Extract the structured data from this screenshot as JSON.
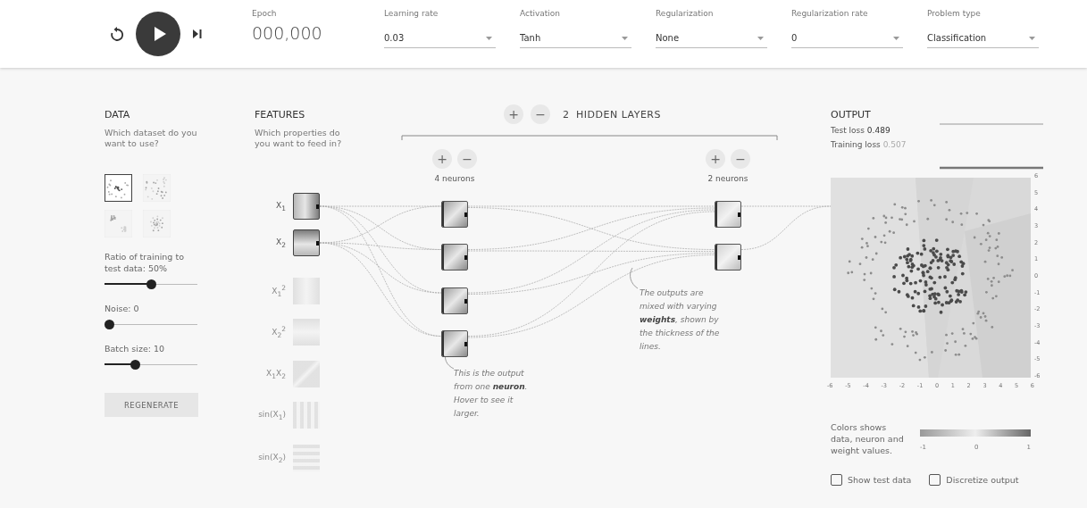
{
  "toolbar": {
    "playing": false,
    "epoch": {
      "label": "Epoch",
      "value": "000,000"
    },
    "dropdowns": [
      {
        "label": "Learning rate",
        "value": "0.03"
      },
      {
        "label": "Activation",
        "value": "Tanh"
      },
      {
        "label": "Regularization",
        "value": "None"
      },
      {
        "label": "Regularization rate",
        "value": "0"
      },
      {
        "label": "Problem type",
        "value": "Classification"
      }
    ]
  },
  "data": {
    "title": "DATA",
    "subtitle": "Which dataset do you want to use?",
    "datasets": [
      {
        "kind": "circle",
        "selected": true
      },
      {
        "kind": "xor",
        "selected": false
      },
      {
        "kind": "gaussian",
        "selected": false
      },
      {
        "kind": "spiral",
        "selected": false
      }
    ],
    "sliders": [
      {
        "label": "Ratio of training to test data:  50%",
        "level": 0.5
      },
      {
        "label": "Noise:  0",
        "level": 0
      },
      {
        "label": "Batch size:  10",
        "level": 0.31
      }
    ],
    "button": "REGENERATE"
  },
  "features": {
    "title": "FEATURES",
    "subtitle": "Which properties do you want to feed in?",
    "items": [
      {
        "label": "X$_{1}$",
        "kind": "x1",
        "selected": true
      },
      {
        "label": "X$_{2}$",
        "kind": "x2",
        "selected": true
      },
      {
        "label": "X$_{1}$$^{2}$",
        "kind": "x1sq",
        "selected": false
      },
      {
        "label": "X$_{2}$$^{2}$",
        "kind": "x2sq",
        "selected": false
      },
      {
        "label": "X$_{1}$X$_{2}$",
        "kind": "x1x2",
        "selected": false
      },
      {
        "label": "sin(X$_{1}$)",
        "kind": "sin1",
        "selected": false
      },
      {
        "label": "sin(X$_{2}$)",
        "kind": "sin2",
        "selected": false
      }
    ]
  },
  "network": {
    "add": "+",
    "remove": "−",
    "count": "2",
    "title": "HIDDEN LAYERS",
    "layers": [
      {
        "add": "+",
        "remove": "−",
        "label": "4 neurons",
        "neurons": [
          {
            "kind": "diagonal"
          },
          {
            "kind": "diagonal"
          },
          {
            "kind": "diagonal"
          },
          {
            "kind": "diagonal"
          }
        ]
      },
      {
        "add": "+",
        "remove": "−",
        "label": "2 neurons",
        "neurons": [
          {
            "kind": "soft"
          },
          {
            "kind": "soft"
          }
        ]
      }
    ],
    "notes": [
      "This is the output from one **neuron**. Hover to see it larger.",
      "The outputs are mixed with varying **weights**, shown by the thickness of the lines."
    ]
  },
  "output": {
    "title": "OUTPUT",
    "losses": [
      {
        "label": "Test loss",
        "value": "0.489"
      },
      {
        "label": "Training loss",
        "value": "0.507"
      }
    ],
    "x_ticks": [
      "-6",
      "-5",
      "-4",
      "-3",
      "-2",
      "-1",
      "0",
      "1",
      "2",
      "3",
      "4",
      "5",
      "6"
    ],
    "y_ticks": [
      "6",
      "5",
      "4",
      "3",
      "2",
      "1",
      "0",
      "-1",
      "-2",
      "-3",
      "-4",
      "-5",
      "-6"
    ],
    "legend": {
      "text": "Colors shows data, neuron and weight values.",
      "scale": [
        "-1",
        "0",
        "1"
      ]
    },
    "options": [
      {
        "label": "Show test data",
        "checked": false
      },
      {
        "label": "Discretize output",
        "checked": false
      }
    ]
  }
}
